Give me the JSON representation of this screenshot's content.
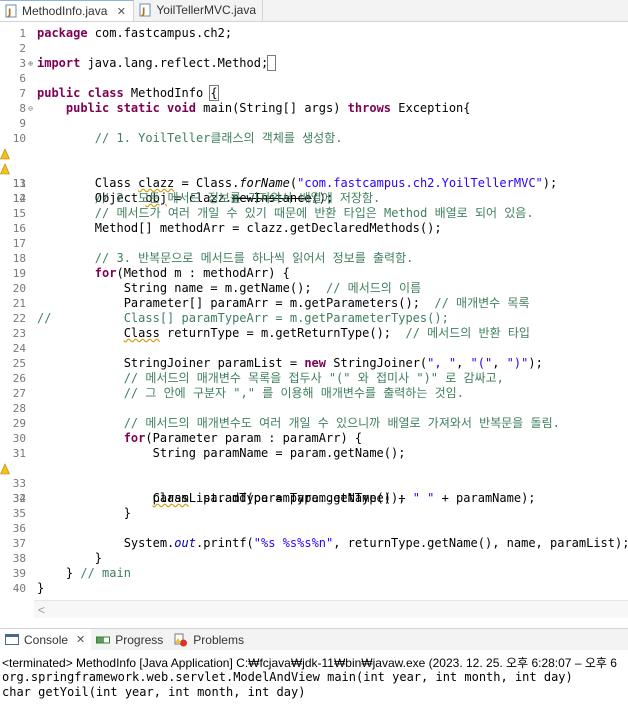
{
  "editor_tabs": [
    {
      "label": "MethodInfo.java",
      "close": "✕"
    },
    {
      "label": "YoilTellerMVC.java"
    }
  ],
  "code": {
    "package_kw": "package",
    "package_name": " com.fastcampus.ch2;",
    "import_kw": "import",
    "import_name": " java.lang.reflect.Method;",
    "class_mods": "public class",
    "class_name": " MethodInfo ",
    "class_brace": "{",
    "main_mods": "public static void",
    "main_sig": " main(String[] args) ",
    "throws_kw": "throws",
    "main_exc": " Exception{",
    "c1": "// 1. YoilTeller클래스의 객체를 생성함.",
    "l11a": "Class ",
    "l11b": "clazz",
    "l11c": " = Class.",
    "l11d": "forName",
    "l11e": "(",
    "l11f": "\"com.fastcampus.ch2.YoilTellerMVC\"",
    "l11g": ");",
    "l12a": "Object ",
    "l12b": "obj",
    "l12c": " = clazz.",
    "l12d": "newInstance",
    "l12e": "();",
    "c2": "// 2. 모든 메서드 정보를 가져와서 배열에 저장함.",
    "c3": "// 메서드가 여러 개일 수 있기 때문에 반환 타입은 Method 배열로 되어 있음.",
    "l16": "Method[] methodArr = clazz.getDeclaredMethods();",
    "c4": "// 3. 반복문으로 메서드를 하나씩 읽어서 정보를 출력함.",
    "for_kw": "for",
    "l19": "(Method m : methodArr) {",
    "l20a": "String name = m.getName();  ",
    "l20b": "// 메서드의 이름",
    "l21a": "Parameter[] paramArr = m.getParameters();  ",
    "l21b": "// 매개변수 목록",
    "l22": "//          Class[] paramTypeArr = m.getParameterTypes();",
    "l23a": "Class",
    "l23b": " returnType = m.getReturnType();  ",
    "l23c": "// 메서드의 반환 타입",
    "l25a": "StringJoiner paramList = ",
    "new_kw": "new",
    "l25b": " StringJoiner(",
    "l25c": "\", \"",
    "l25d": ", ",
    "l25e": "\"(\"",
    "l25f": ", ",
    "l25g": "\")\"",
    "l25h": ");",
    "c5": "// 메서드의 매개변수 목록을 접두사 \"(\" 와 접미사 \")\" 로 감싸고,",
    "c6": "// 그 안에 구분자 \",\" 를 이용해 매개변수를 출력하는 것임.",
    "c7": "// 메서드의 매개변수도 여러 개일 수 있으니까 배열로 가져와서 반복문을 돌림.",
    "l30": "(Parameter param : paramArr) {",
    "l31": "String paramName = param.getName();",
    "l32a": "Class",
    "l32b": "  paramType = param.getType();",
    "l34a": "paramList.add(paramType.getName() + ",
    "l34b": "\" \"",
    "l34c": " + paramName);",
    "brace": "}",
    "l37a": "System.",
    "l37b": "out",
    "l37c": ".printf(",
    "l37d": "\"%s %s%s%n\"",
    "l37e": ", returnType.getName(), name, paramList);",
    "l39a": "} ",
    "l39b": "// main"
  },
  "view_tabs": [
    {
      "label": "Console",
      "close": "✕"
    },
    {
      "label": "Progress"
    },
    {
      "label": "Problems"
    }
  ],
  "console": {
    "terminated": "<terminated> MethodInfo [Java Application] C:₩fcjava₩jdk-11₩bin₩javaw.exe  (2023. 12. 25. 오후 6:28:07 – 오후 6",
    "out1": "org.springframework.web.servlet.ModelAndView main(int year, int month, int day)",
    "out2": "char getYoil(int year, int month, int day)"
  },
  "colors": {
    "keyword": "#7f0055",
    "comment": "#3f7f5f",
    "string": "#2a00ff",
    "field": "#0000c0",
    "line_number": "#787878"
  }
}
